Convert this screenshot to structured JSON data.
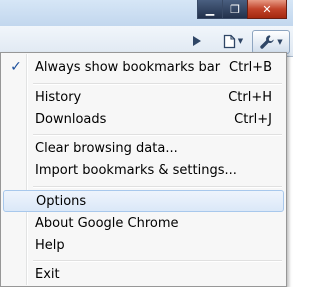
{
  "window": {
    "minimize_glyph": "▁",
    "restore_glyph": "❐",
    "close_glyph": "✕"
  },
  "toolbar": {
    "icons": [
      "play-icon",
      "page-icon",
      "wrench-icon"
    ]
  },
  "menu": {
    "check_glyph": "✓",
    "items": [
      {
        "label": "Always show bookmarks bar",
        "shortcut": "Ctrl+B",
        "checked": true
      },
      {
        "label": "History",
        "shortcut": "Ctrl+H"
      },
      {
        "label": "Downloads",
        "shortcut": "Ctrl+J"
      },
      {
        "label": "Clear browsing data...",
        "shortcut": ""
      },
      {
        "label": "Import bookmarks & settings...",
        "shortcut": ""
      },
      {
        "label": "Options",
        "shortcut": "",
        "highlighted": true
      },
      {
        "label": "About Google Chrome",
        "shortcut": ""
      },
      {
        "label": "Help",
        "shortcut": ""
      },
      {
        "label": "Exit",
        "shortcut": ""
      }
    ]
  },
  "colors": {
    "highlight_border": "#a8c8ec",
    "check": "#1c4f9c",
    "close_button": "#c2432a"
  }
}
